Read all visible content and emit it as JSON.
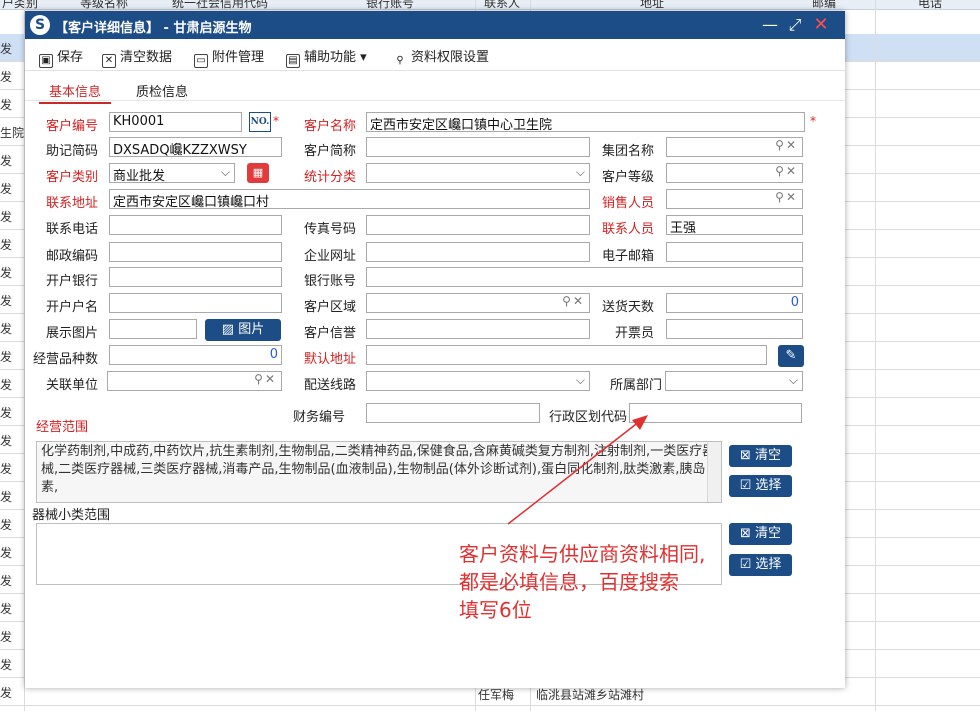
{
  "background": {
    "headers": [
      "户类别",
      "等级名称",
      "统一社会信用代码",
      "银行账号",
      "联系人",
      "地址",
      "邮编",
      "电话"
    ],
    "row_prefixes": [
      "发",
      "发",
      "发",
      "生院",
      "发",
      "发",
      "发",
      "发",
      "发",
      "发",
      "发",
      "发",
      "发",
      "发",
      "发",
      "发",
      "发",
      "发",
      "发",
      "发",
      "发",
      "发",
      "发",
      "发",
      "发"
    ],
    "last_row_contact": "任军梅",
    "last_row_address": "临洮县站滩乡站滩村"
  },
  "dialog": {
    "title": "【客户详细信息】 - 甘肃启源生物",
    "logo_glyph": "S",
    "controls": {
      "minimize": "—",
      "maximize": "⤢",
      "close": "✕"
    },
    "toolbar": [
      {
        "label": "保存",
        "icon": "save-icon"
      },
      {
        "label": "清空数据",
        "icon": "clear-icon"
      },
      {
        "label": "附件管理",
        "icon": "folder-icon"
      },
      {
        "label": "辅助功能",
        "icon": "tool-icon",
        "dropdown": "▾"
      },
      {
        "label": "资料权限设置",
        "icon": "key-icon"
      }
    ],
    "tabs": [
      "基本信息",
      "质检信息"
    ],
    "fields": {
      "customer_code": {
        "label": "客户编号",
        "value": "KH0001",
        "badge": "NO."
      },
      "customer_name": {
        "label": "客户名称",
        "value": "定西市安定区巉口镇中心卫生院"
      },
      "mnemonic": {
        "label": "助记简码",
        "value": "DXSADQ巉KZZXWSY"
      },
      "short_name": {
        "label": "客户简称",
        "value": ""
      },
      "group_name": {
        "label": "集团名称",
        "value": ""
      },
      "customer_type": {
        "label": "客户类别",
        "value": "商业批发"
      },
      "stat_category": {
        "label": "统计分类",
        "value": ""
      },
      "customer_level": {
        "label": "客户等级",
        "value": ""
      },
      "contact_address": {
        "label": "联系地址",
        "value": "定西市安定区巉口镇巉口村"
      },
      "sales_person": {
        "label": "销售人员",
        "value": ""
      },
      "phone": {
        "label": "联系电话",
        "value": ""
      },
      "fax": {
        "label": "传真号码",
        "value": ""
      },
      "contact_person": {
        "label": "联系人员",
        "value": "王强"
      },
      "postcode": {
        "label": "邮政编码",
        "value": ""
      },
      "website": {
        "label": "企业网址",
        "value": ""
      },
      "email": {
        "label": "电子邮箱",
        "value": ""
      },
      "bank": {
        "label": "开户银行",
        "value": ""
      },
      "bank_account": {
        "label": "银行账号",
        "value": ""
      },
      "account_name": {
        "label": "开户户名",
        "value": ""
      },
      "region": {
        "label": "客户区域",
        "value": ""
      },
      "delivery_days": {
        "label": "送货天数",
        "value": "0"
      },
      "display_image": {
        "label": "展示图片",
        "value": "",
        "button": "图片"
      },
      "credit": {
        "label": "客户信誉",
        "value": ""
      },
      "invoicer": {
        "label": "开票员",
        "value": ""
      },
      "product_count": {
        "label": "经营品种数",
        "value": "0"
      },
      "default_address": {
        "label": "默认地址",
        "value": ""
      },
      "related_unit": {
        "label": "关联单位",
        "value": ""
      },
      "delivery_route": {
        "label": "配送线路",
        "value": ""
      },
      "department": {
        "label": "所属部门",
        "value": ""
      },
      "finance_code": {
        "label": "财务编号",
        "value": ""
      },
      "admin_code": {
        "label": "行政区划代码",
        "value": ""
      }
    },
    "business_scope": {
      "label": "经营范围",
      "text": "化学药制剂,中成药,中药饮片,抗生素制剂,生物制品,二类精神药品,保健食品,含麻黄碱类复方制剂,注射制剂,一类医疗器械,二类医疗器械,三类医疗器械,消毒产品,生物制品(血液制品),生物制品(体外诊断试剂),蛋白同化制剂,肽类激素,胰岛素,",
      "clear": "清空",
      "choose": "选择"
    },
    "device_scope": {
      "label": "器械小类范围",
      "text": "",
      "clear": "清空",
      "choose": "选择"
    }
  },
  "annotation": {
    "line1": "客户资料与供应商资料相同,",
    "line2": "都是必填信息，百度搜索",
    "line3": "填写6位",
    "color": "#e03030"
  },
  "colors": {
    "brand": "#1d4d86",
    "required": "#d42020",
    "close": "#ff4d4d"
  }
}
